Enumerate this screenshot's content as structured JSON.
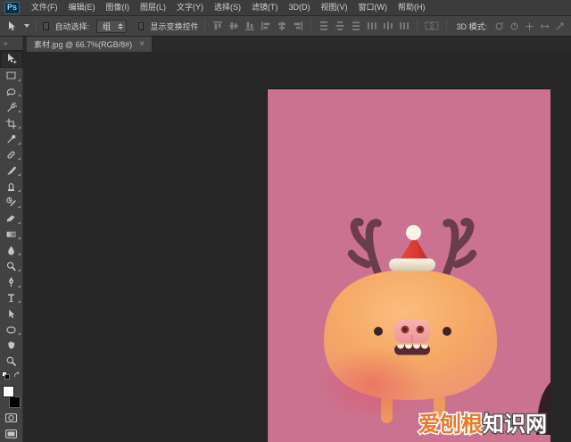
{
  "app": {
    "logo_text": "Ps",
    "menus": [
      "文件(F)",
      "编辑(E)",
      "图像(I)",
      "图层(L)",
      "文字(Y)",
      "选择(S)",
      "滤镜(T)",
      "3D(D)",
      "视图(V)",
      "窗口(W)",
      "帮助(H)"
    ]
  },
  "options_bar": {
    "auto_select_label": "自动选择:",
    "auto_select_value": "组",
    "show_transform_label": "显示变换控件",
    "mode_3d_label": "3D 模式:"
  },
  "document_tab": {
    "title": "素材.jpg @ 66.7%(RGB/8#)",
    "close": "×"
  },
  "toolbar": {
    "collapse": "»",
    "tools": [
      "move",
      "rectangular-marquee",
      "lasso",
      "quick-selection",
      "crop",
      "eyedropper",
      "spot-healing-brush",
      "brush",
      "clone-stamp",
      "history-brush",
      "eraser",
      "gradient",
      "blur",
      "dodge",
      "pen",
      "horizontal-type",
      "path-selection",
      "ellipse-shape",
      "hand",
      "zoom"
    ],
    "foreground_color": "#ffffff",
    "background_color": "#000000"
  },
  "canvas": {
    "background_color": "#cb7290",
    "subject": "cartoon pig with reindeer antlers and santa hat on pink background",
    "watermark_left": "爱刨根",
    "watermark_right": "知识网",
    "watermark_left_color": "#e8792c",
    "watermark_right_color": "#ffffff"
  },
  "colors": {
    "menubar_bg": "#3c3c3c",
    "optionsbar_bg": "#434343",
    "toolbar_bg": "#424242",
    "workspace_bg": "#272727",
    "tab_bg": "#474747",
    "logo_blue": "#8ed0f0"
  }
}
